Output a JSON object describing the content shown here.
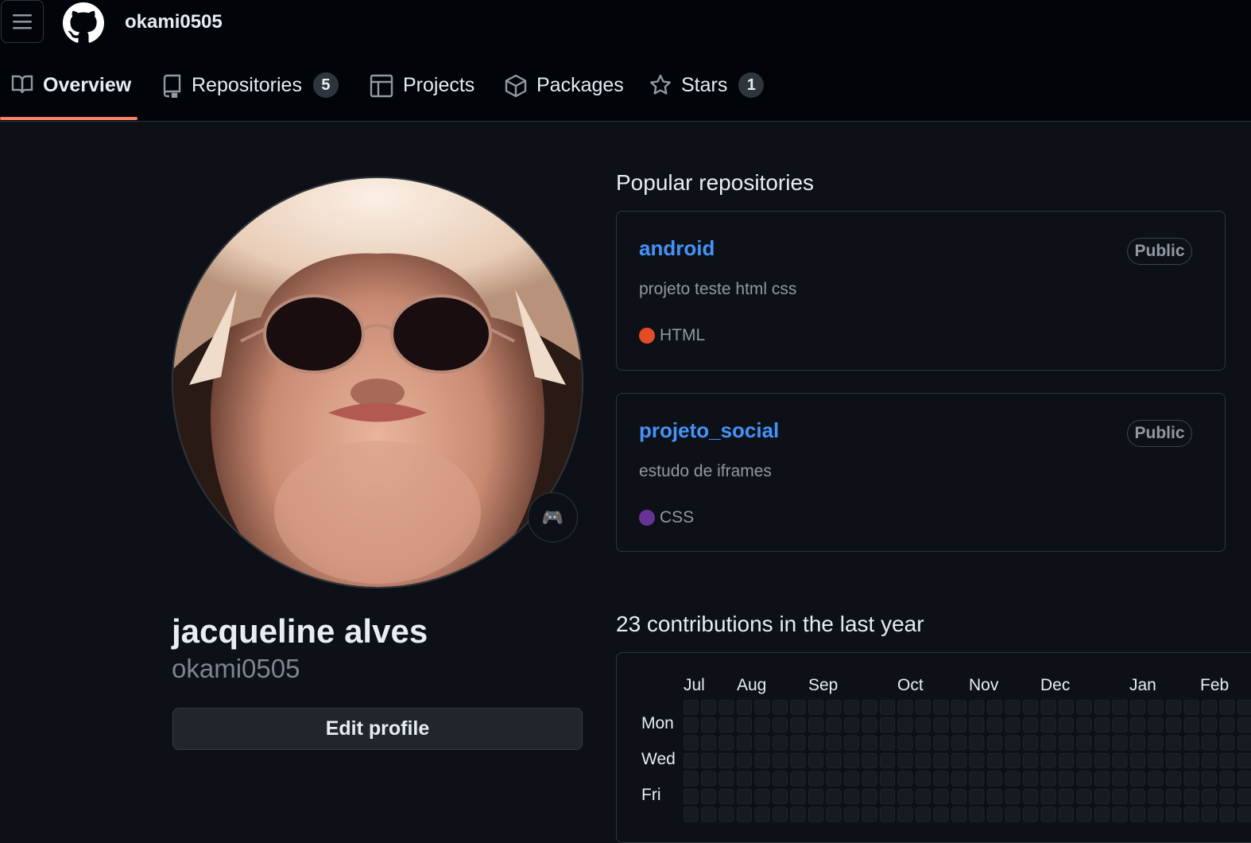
{
  "header": {
    "username": "okami0505",
    "icons": {
      "menu": "hamburger-icon",
      "logo": "github-logo-icon"
    }
  },
  "tabs": [
    {
      "label": "Overview",
      "icon": "book-icon"
    },
    {
      "label": "Repositories",
      "icon": "repo-icon",
      "count": "5"
    },
    {
      "label": "Projects",
      "icon": "table-icon"
    },
    {
      "label": "Packages",
      "icon": "package-icon"
    },
    {
      "label": "Stars",
      "icon": "star-icon",
      "count": "1"
    }
  ],
  "profile": {
    "full_name": "jacqueline alves",
    "login": "okami0505",
    "edit_label": "Edit profile",
    "status_icon": "gamepad-icon"
  },
  "popular": {
    "title": "Popular repositories",
    "repos": [
      {
        "name": "android",
        "visibility": "Public",
        "description": "projeto teste html css",
        "language": "HTML",
        "color": "#e34c26"
      },
      {
        "name": "projeto_social",
        "visibility": "Public",
        "description": "estudo de iframes",
        "language": "CSS",
        "color": "#663399"
      }
    ]
  },
  "contributions": {
    "title": "23 contributions in the last year",
    "months": [
      "Jul",
      "Aug",
      "Sep",
      "Oct",
      "Nov",
      "Dec",
      "Jan",
      "Feb"
    ],
    "days": [
      "Mon",
      "Wed",
      "Fri"
    ],
    "cell_color": "#161b22"
  },
  "colors": {
    "accent": "#f78166",
    "link": "#4493f8",
    "bg": "#0d1117",
    "header_bg": "#010409"
  }
}
